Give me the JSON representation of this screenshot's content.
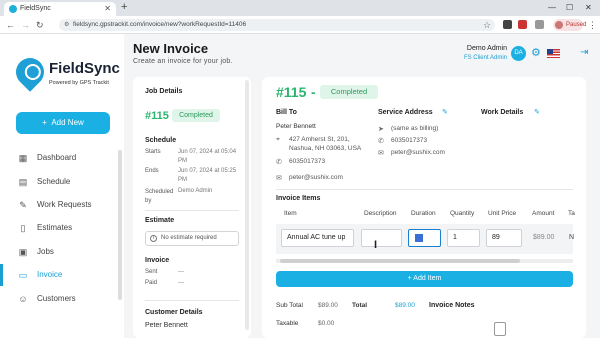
{
  "browser": {
    "tab_title": "FieldSync",
    "url": "fieldsync.gpstrackit.com/invoice/new?workRequestId=11406",
    "profile_status": "Paused"
  },
  "sidebar": {
    "brand": "FieldSync",
    "brand_sub": "Powered by GPS Trackit",
    "add_new": "Add New",
    "items": [
      {
        "label": "Dashboard",
        "icon": "dashboard-icon"
      },
      {
        "label": "Schedule",
        "icon": "calendar-icon"
      },
      {
        "label": "Work Requests",
        "icon": "wrench-icon"
      },
      {
        "label": "Estimates",
        "icon": "document-icon"
      },
      {
        "label": "Jobs",
        "icon": "briefcase-icon"
      },
      {
        "label": "Invoice",
        "icon": "invoice-icon"
      },
      {
        "label": "Customers",
        "icon": "people-icon"
      }
    ],
    "active": "Invoice"
  },
  "header": {
    "title": "New Invoice",
    "subtitle": "Create an invoice for your job.",
    "user_name": "Demo Admin",
    "user_role": "FS Client Admin",
    "avatar_initials": "DA"
  },
  "job_details": {
    "heading": "Job Details",
    "number": "#115",
    "status": "Completed",
    "schedule_heading": "Schedule",
    "starts_label": "Starts",
    "starts_value": "Jun 07, 2024 at 05:04 PM",
    "ends_label": "Ends",
    "ends_value": "Jun 07, 2024 at 05:25 PM",
    "scheduled_by_label": "Scheduled by",
    "scheduled_by_value": "Demo Admin",
    "estimate_heading": "Estimate",
    "estimate_box": "No estimate required",
    "invoice_heading": "Invoice",
    "sent_label": "Sent",
    "sent_value": "---",
    "paid_label": "Paid",
    "paid_value": "---",
    "customer_heading": "Customer Details",
    "customer_name": "Peter Bennett"
  },
  "invoice": {
    "number": "#115",
    "dash": "-",
    "status": "Completed",
    "bill_to_label": "Bill To",
    "bill_name": "Peter Bennett",
    "bill_address": "427 Amherst St, 201, Nashua, NH 03063, USA",
    "bill_phone": "6035017373",
    "bill_email": "peter@sushix.com",
    "service_address_label": "Service Address",
    "service_same": "(same as billing)",
    "service_phone": "6035017373",
    "service_email": "peter@sushix.com",
    "work_details_label": "Work Details",
    "items_heading": "Invoice Items",
    "columns": [
      "Item",
      "Description",
      "Duration",
      "Quantity",
      "Unit Price",
      "Amount",
      "Ta"
    ],
    "row": {
      "item": "Annual AC tune up",
      "description": "",
      "duration": "",
      "quantity": "1",
      "unit_price": "89",
      "amount": "$89.00",
      "tax": "N"
    },
    "add_item": "+ Add Item",
    "sub_total_label": "Sub Total",
    "sub_total_value": "$89.00",
    "total_label": "Total",
    "total_value": "$89.00",
    "taxable_label": "Taxable",
    "taxable_value": "$0.00",
    "notes_label": "Invoice Notes"
  }
}
